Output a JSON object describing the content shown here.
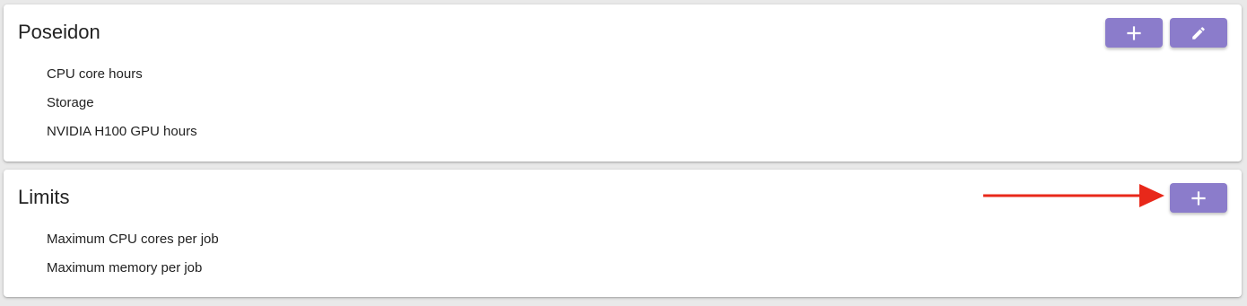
{
  "poseidon": {
    "title": "Poseidon",
    "items": [
      {
        "label": "CPU core hours"
      },
      {
        "label": "Storage"
      },
      {
        "label": "NVIDIA H100 GPU hours"
      }
    ],
    "add_icon": "plus-icon",
    "edit_icon": "pencil-icon"
  },
  "limits": {
    "title": "Limits",
    "items": [
      {
        "label": "Maximum CPU cores per job"
      },
      {
        "label": "Maximum memory per job"
      }
    ],
    "add_icon": "plus-icon"
  },
  "annotation": {
    "icon": "arrow-right-icon",
    "color": "#e8281a"
  },
  "colors": {
    "button": "#8b7ccb",
    "background": "#e9e9e9",
    "card": "#ffffff"
  }
}
